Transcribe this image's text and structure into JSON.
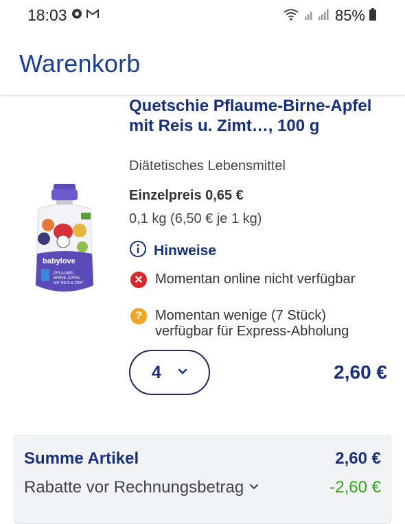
{
  "status_bar": {
    "time": "18:03",
    "battery": "85%",
    "icons": [
      "notification-dot-icon",
      "gmail-icon",
      "wifi-icon",
      "signal-icon",
      "battery-icon"
    ]
  },
  "header": {
    "title": "Warenkorb"
  },
  "product": {
    "title": "Quetschie Pflaume-Birne-Apfel mit Reis u. Zimt…, 100 g",
    "category": "Diätetisches Lebensmittel",
    "unit_price": "Einzelpreis 0,65 €",
    "base_price": "0,1 kg (6,50 € je 1 kg)",
    "hint_label": "Hinweise",
    "availability": [
      {
        "text": "Momentan online nicht verfügbar",
        "color": "#d62a2a",
        "icon": "error-x-icon"
      },
      {
        "text": "Momentan wenige (7 Stück) verfügbar für Express-Abholung",
        "color": "#f2a626",
        "icon": "question-icon"
      }
    ],
    "image": {
      "brand": "babylove",
      "label": "PFLAUME-BIRNE-APFEL MIT REIS & ZIMT",
      "badge": "BIO"
    },
    "quantity": "4",
    "line_total": "2,60 €"
  },
  "summary": {
    "items_label": "Summe Artikel",
    "items_value": "2,60 €",
    "discount_label": "Rabatte vor Rechnungsbetrag",
    "discount_value": "-2,60 €"
  },
  "colors": {
    "brand_blue": "#16307e",
    "discount_green": "#2fa51e",
    "error_red": "#d62a2a",
    "warning_orange": "#f2a626"
  }
}
